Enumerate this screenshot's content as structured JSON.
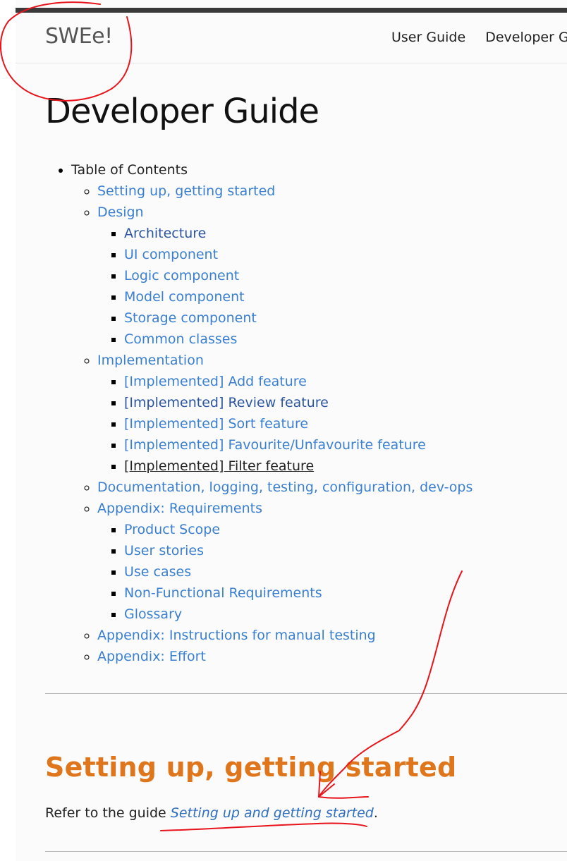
{
  "navbar": {
    "brand": "SWEe!",
    "links": [
      "User Guide",
      "Developer Guide"
    ]
  },
  "page_title": "Developer Guide",
  "toc": {
    "label": "Table of Contents",
    "sections": [
      {
        "label": "Setting up, getting started",
        "children": []
      },
      {
        "label": "Design",
        "children": [
          "Architecture",
          "UI component",
          "Logic component",
          "Model component",
          "Storage component",
          "Common classes"
        ]
      },
      {
        "label": "Implementation",
        "children": [
          "[Implemented] Add feature",
          "[Implemented] Review feature",
          "[Implemented] Sort feature",
          "[Implemented] Favourite/Unfavourite feature",
          "[Implemented] Filter feature"
        ]
      },
      {
        "label": "Documentation, logging, testing, configuration, dev-ops",
        "children": []
      },
      {
        "label": "Appendix: Requirements",
        "children": [
          "Product Scope",
          "User stories",
          "Use cases",
          "Non-Functional Requirements",
          "Glossary"
        ]
      },
      {
        "label": "Appendix: Instructions for manual testing",
        "children": []
      },
      {
        "label": "Appendix: Effort",
        "children": []
      }
    ]
  },
  "section": {
    "heading": "Setting up, getting started",
    "text_before": "Refer to the guide ",
    "link_text": "Setting up and getting started",
    "text_after": "."
  },
  "colors": {
    "link": "#3a7fd1",
    "visited_link": "#2b55a3",
    "heading_orange": "#e0761c",
    "annotation_red": "#e8141c",
    "topbar": "#3a3a3a"
  }
}
